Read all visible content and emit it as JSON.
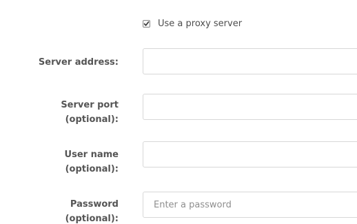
{
  "proxy": {
    "checkbox_label": "Use a proxy server",
    "checked": true
  },
  "fields": {
    "server_address": {
      "label": "Server address:",
      "value": "",
      "placeholder": ""
    },
    "server_port": {
      "label_line1": "Server port",
      "label_line2": "(optional):",
      "value": "",
      "placeholder": ""
    },
    "user_name": {
      "label_line1": "User name",
      "label_line2": "(optional):",
      "value": "",
      "placeholder": ""
    },
    "password": {
      "label_line1": "Password",
      "label_line2": "(optional):",
      "value": "",
      "placeholder": "Enter a password"
    }
  },
  "icons": {
    "checkbox_mark": "checkmark-icon"
  }
}
